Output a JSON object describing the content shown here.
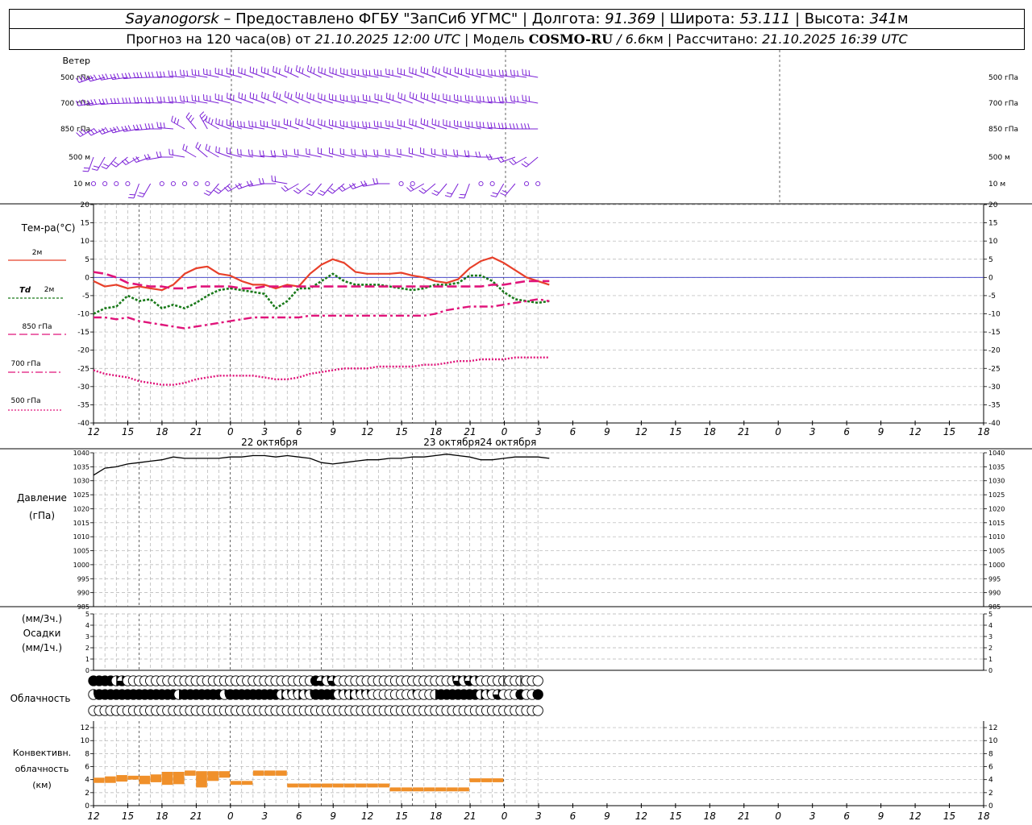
{
  "header": {
    "line1": {
      "station": "Sayanogorsk",
      "provider": " – Предоставлено ФГБУ \"ЗапСиб УГМС\" | Долгота: ",
      "lon": "91.369",
      "lat_label": " | Широта: ",
      "lat": "53.111",
      "alt_label": " | Высота: ",
      "alt": "341",
      "alt_unit": "м"
    },
    "line2": {
      "forecast_label": "Прогноз на 120 часа(ов) от ",
      "forecast_date": "21.10.2025 12:00 UTC",
      "model_label": " | Модель ",
      "model": "COSMO-RU",
      "res": " / 6.6",
      "res_unit": "км",
      "calc_label": " | Рассчитано: ",
      "calc_date": "21.10.2025 16:39 UTC"
    }
  },
  "time_axis": {
    "labels": [
      "12",
      "15",
      "18",
      "21",
      "0",
      "3",
      "6",
      "9",
      "12",
      "15",
      "18",
      "21",
      "0",
      "3",
      "6",
      "9",
      "12",
      "15",
      "18",
      "21",
      "0",
      "3",
      "6",
      "9",
      "12",
      "15",
      "18"
    ],
    "dates": [
      "22 октября",
      "23 октября",
      "24 октября"
    ]
  },
  "wind_panel": {
    "title": "Ветер",
    "levels": [
      "500 гПа",
      "700 гПа",
      "850 гПа",
      "500 м",
      "10 м"
    ],
    "color": "#7a1fd6"
  },
  "temperature_panel": {
    "title": "Тем-ра(°C)",
    "legend": [
      {
        "label": "2м",
        "color": "#e8402a"
      },
      {
        "label": "Td",
        "label2": "2м",
        "color": "#1a7a1a"
      },
      {
        "label": "850 гПа",
        "color": "#e0147a"
      },
      {
        "label": "700 гПа",
        "color": "#e0147a"
      },
      {
        "label": "500 гПа",
        "color": "#e0147a"
      }
    ],
    "yticks": [
      "20",
      "15",
      "10",
      "5",
      "0",
      "-5",
      "-10",
      "-15",
      "-20",
      "-25",
      "-30",
      "-35",
      "-40"
    ]
  },
  "pressure_panel": {
    "title": "Давление",
    "unit": "(гПа)",
    "yticks": [
      "1040",
      "1035",
      "1030",
      "1025",
      "1020",
      "1015",
      "1010",
      "1005",
      "1000",
      "995",
      "990",
      "985"
    ]
  },
  "precip_panel": {
    "unit3": "(мм/3ч.)",
    "title": "Осадки",
    "unit1": "(мм/1ч.)",
    "yticks": [
      "5",
      "4",
      "3",
      "2",
      "1",
      "0"
    ]
  },
  "cloud_panel": {
    "title": "Облачность"
  },
  "conv_panel": {
    "title1": "Конвективн.",
    "title2": "облачность",
    "unit": "(км)",
    "yticks": [
      "12",
      "10",
      "8",
      "6",
      "4",
      "2",
      "0"
    ],
    "color": "#f0902a"
  },
  "chart_data": [
    {
      "type": "line",
      "title": "Тем-ра(°C)",
      "x_hours": [
        0,
        3,
        6,
        9,
        12,
        15,
        18,
        21,
        24,
        27,
        30,
        33,
        36,
        39,
        42,
        45,
        48,
        51,
        54,
        57,
        60,
        63,
        66,
        69,
        72,
        75,
        78,
        81,
        84,
        87,
        90,
        93,
        96,
        99,
        102,
        105,
        108,
        111,
        114,
        117,
        120
      ],
      "ylim": [
        -40,
        20
      ],
      "series": [
        {
          "name": "2м",
          "values": [
            -1,
            -2.5,
            -2,
            -3,
            -2.5,
            -3,
            -3.5,
            -2,
            1,
            2.5,
            3,
            1,
            0.5,
            -1,
            -2,
            -2,
            -3,
            -2,
            -2.5,
            1,
            3.5,
            5,
            4,
            1.5,
            1,
            1,
            1,
            1.3,
            0.5,
            0,
            -1,
            -1.5,
            -0.5,
            2.5,
            4.5,
            5.5,
            4,
            2,
            0,
            -1,
            -2
          ]
        },
        {
          "name": "Td 2м",
          "values": [
            -10,
            -8.5,
            -8,
            -5,
            -6.5,
            -6,
            -8.5,
            -7.5,
            -8.5,
            -7,
            -5,
            -3.5,
            -3,
            -3.5,
            -4,
            -4.5,
            -8.5,
            -6.5,
            -3,
            -3,
            -1,
            1,
            -1,
            -2,
            -2,
            -2,
            -2.5,
            -3,
            -3.5,
            -3,
            -2,
            -2,
            -1.5,
            0.5,
            0.5,
            -1,
            -4,
            -6,
            -6.5,
            -7,
            -6.5
          ]
        },
        {
          "name": "850 гПа",
          "values": [
            1.5,
            1,
            0,
            -1.5,
            -2,
            -2.5,
            -2.5,
            -3,
            -3,
            -2.5,
            -2.5,
            -2.5,
            -2.5,
            -3,
            -3,
            -2.5,
            -2.5,
            -2.5,
            -2.5,
            -2.5,
            -2.5,
            -2.5,
            -2.5,
            -2.5,
            -2.5,
            -2.5,
            -2.5,
            -2.5,
            -2.5,
            -2.5,
            -2.5,
            -2.5,
            -2.5,
            -2.5,
            -2.5,
            -2,
            -2,
            -1.5,
            -1,
            -1,
            -1
          ]
        },
        {
          "name": "700 гПа",
          "values": [
            -11,
            -11,
            -11.5,
            -11,
            -12,
            -12.5,
            -13,
            -13.5,
            -14,
            -13.5,
            -13,
            -12.5,
            -12,
            -11.5,
            -11,
            -11,
            -11,
            -11,
            -11,
            -10.5,
            -10.5,
            -10.5,
            -10.5,
            -10.5,
            -10.5,
            -10.5,
            -10.5,
            -10.5,
            -10.5,
            -10.5,
            -10,
            -9,
            -8.5,
            -8,
            -8,
            -8,
            -7.5,
            -7,
            -6.5,
            -6,
            -6.5
          ]
        },
        {
          "name": "500 гПа",
          "values": [
            -25.5,
            -26.5,
            -27,
            -27.5,
            -28.5,
            -29,
            -29.5,
            -29.5,
            -29,
            -28,
            -27.5,
            -27,
            -27,
            -27,
            -27,
            -27.5,
            -28,
            -28,
            -27.5,
            -26.5,
            -26,
            -25.5,
            -25,
            -25,
            -25,
            -24.5,
            -24.5,
            -24.5,
            -24.5,
            -24,
            -24,
            -23.5,
            -23,
            -23,
            -22.5,
            -22.5,
            -22.5,
            -22,
            -22,
            -22,
            -22
          ]
        }
      ]
    },
    {
      "type": "line",
      "title": "Давление",
      "x_hours": [
        0,
        3,
        6,
        9,
        12,
        15,
        18,
        21,
        24,
        27,
        30,
        33,
        36,
        39,
        42,
        45,
        48,
        51,
        54,
        57,
        60,
        63,
        66,
        69,
        72,
        75,
        78,
        81,
        84,
        87,
        90,
        93,
        96,
        99,
        102,
        105,
        108,
        111,
        114,
        117,
        120
      ],
      "ylim": [
        985,
        1040
      ],
      "series": [
        {
          "name": "Давление",
          "values": [
            1032,
            1034.5,
            1035,
            1036,
            1036.5,
            1037,
            1037.5,
            1038.5,
            1038,
            1038,
            1038,
            1038,
            1038.5,
            1038.5,
            1039,
            1039,
            1038.5,
            1039,
            1038.5,
            1038,
            1036.5,
            1036,
            1036.5,
            1037,
            1037.5,
            1037.5,
            1038,
            1038,
            1038.5,
            1038.5,
            1039,
            1039.5,
            1039,
            1038.5,
            1037.5,
            1037.5,
            1038,
            1038.5,
            1038.5,
            1038.5,
            1038
          ]
        }
      ]
    },
    {
      "type": "bar",
      "title": "Конвективн. облачность",
      "ylim": [
        0,
        13
      ],
      "bars": [
        {
          "x": 0,
          "base": 3.5,
          "top": 4.3
        },
        {
          "x": 3,
          "base": 3.5,
          "top": 4.5
        },
        {
          "x": 6,
          "base": 3.7,
          "top": 4.7
        },
        {
          "x": 9,
          "base": 4,
          "top": 4.6
        },
        {
          "x": 12,
          "base": 3.3,
          "top": 4.6
        },
        {
          "x": 15,
          "base": 3.6,
          "top": 4.8
        },
        {
          "x": 18,
          "base": 3.2,
          "top": 5.2
        },
        {
          "x": 21,
          "base": 3.3,
          "top": 5.2
        },
        {
          "x": 24,
          "base": 4.6,
          "top": 5.4
        },
        {
          "x": 27,
          "base": 2.8,
          "top": 5.3
        },
        {
          "x": 30,
          "base": 3.8,
          "top": 5.3
        },
        {
          "x": 33,
          "base": 4.3,
          "top": 5.3
        },
        {
          "x": 36,
          "base": 3.2,
          "top": 3.8
        },
        {
          "x": 39,
          "base": 3.2,
          "top": 3.8
        },
        {
          "x": 42,
          "base": 4.6,
          "top": 5.4
        },
        {
          "x": 45,
          "base": 4.6,
          "top": 5.4
        },
        {
          "x": 48,
          "base": 4.6,
          "top": 5.4
        },
        {
          "x": 51,
          "base": 2.8,
          "top": 3.4
        },
        {
          "x": 54,
          "base": 2.8,
          "top": 3.4
        },
        {
          "x": 57,
          "base": 2.8,
          "top": 3.4
        },
        {
          "x": 60,
          "base": 2.8,
          "top": 3.4
        },
        {
          "x": 63,
          "base": 2.8,
          "top": 3.4
        },
        {
          "x": 66,
          "base": 2.8,
          "top": 3.4
        },
        {
          "x": 69,
          "base": 2.8,
          "top": 3.4
        },
        {
          "x": 72,
          "base": 2.8,
          "top": 3.4
        },
        {
          "x": 75,
          "base": 2.8,
          "top": 3.4
        },
        {
          "x": 78,
          "base": 2.2,
          "top": 2.8
        },
        {
          "x": 81,
          "base": 2.2,
          "top": 2.8
        },
        {
          "x": 84,
          "base": 2.2,
          "top": 2.8
        },
        {
          "x": 87,
          "base": 2.2,
          "top": 2.8
        },
        {
          "x": 90,
          "base": 2.2,
          "top": 2.8
        },
        {
          "x": 93,
          "base": 2.2,
          "top": 2.8
        },
        {
          "x": 96,
          "base": 2.2,
          "top": 2.8
        },
        {
          "x": 99,
          "base": 3.6,
          "top": 4.2
        },
        {
          "x": 102,
          "base": 3.6,
          "top": 4.2
        },
        {
          "x": 105,
          "base": 3.6,
          "top": 4.2
        }
      ]
    }
  ]
}
